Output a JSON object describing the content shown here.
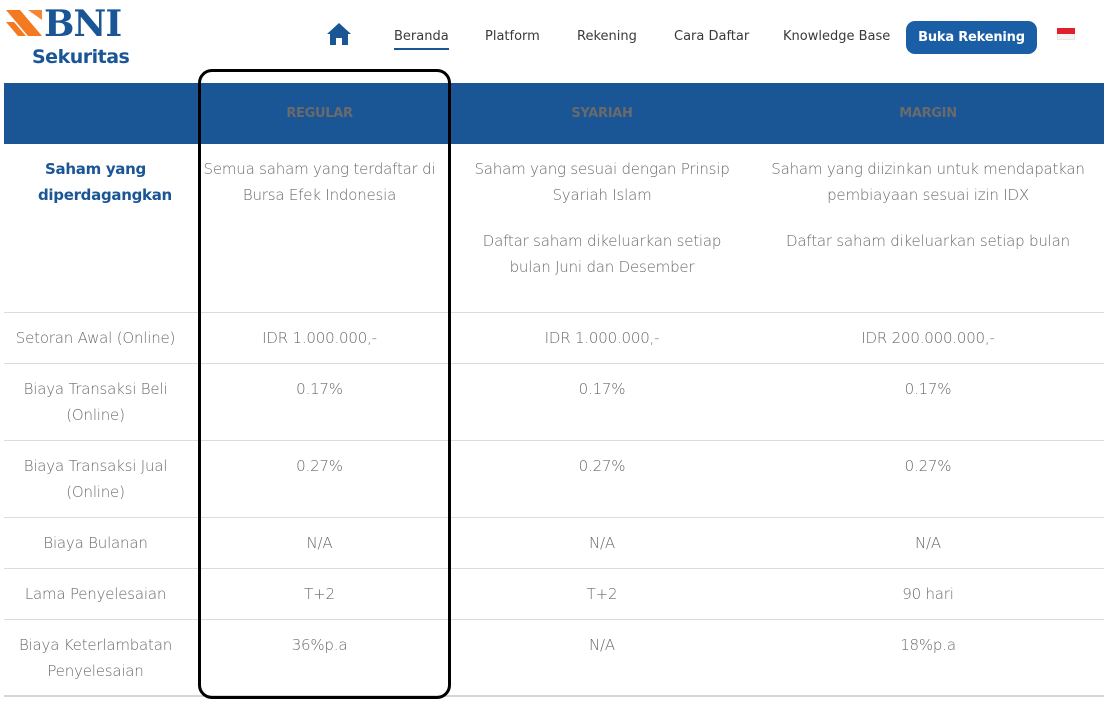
{
  "brand": {
    "name": "BNI",
    "subname": "Sekuritas",
    "colors": {
      "primary": "#1a5596",
      "accent": "#f47920",
      "cta": "#1a5fa6"
    }
  },
  "nav": {
    "home_icon": "home-icon",
    "items": [
      {
        "label": "Beranda",
        "active": true
      },
      {
        "label": "Platform"
      },
      {
        "label": "Rekening"
      },
      {
        "label": "Cara Daftar"
      },
      {
        "label": "Knowledge Base"
      }
    ],
    "cta_label": "Buka Rekening",
    "language_icon": "indonesia-flag-icon"
  },
  "table": {
    "headers": [
      "",
      "REGULAR",
      "SYARIAH",
      "MARGIN"
    ],
    "rows": [
      {
        "label": "Saham yang diperdagangkan",
        "regular": [
          "Semua saham yang terdaftar di Bursa Efek Indonesia"
        ],
        "syariah": [
          "Saham yang sesuai dengan Prinsip Syariah Islam",
          "Daftar saham dikeluarkan setiap bulan Juni dan Desember"
        ],
        "margin": [
          "Saham yang diizinkan untuk mendapatkan pembiayaan sesuai izin IDX",
          "Daftar saham dikeluarkan setiap bulan"
        ]
      },
      {
        "label": "Setoran Awal (Online)",
        "regular": "IDR 1.000.000,-",
        "syariah": "IDR 1.000.000,-",
        "margin": "IDR 200.000.000,-"
      },
      {
        "label": "Biaya Transaksi Beli (Online)",
        "regular": "0.17%",
        "syariah": "0.17%",
        "margin": "0.17%"
      },
      {
        "label": "Biaya Transaksi Jual (Online)",
        "regular": "0.27%",
        "syariah": "0.27%",
        "margin": "0.27%"
      },
      {
        "label": "Biaya Bulanan",
        "regular": "N/A",
        "syariah": "N/A",
        "margin": "N/A"
      },
      {
        "label": "Lama Penyelesaian",
        "regular": "T+2",
        "syariah": "T+2",
        "margin": "90 hari"
      },
      {
        "label": "Biaya Keterlambatan Penyelesaian",
        "regular": "36%p.a",
        "syariah": "N/A",
        "margin": "18%p.a"
      }
    ]
  }
}
